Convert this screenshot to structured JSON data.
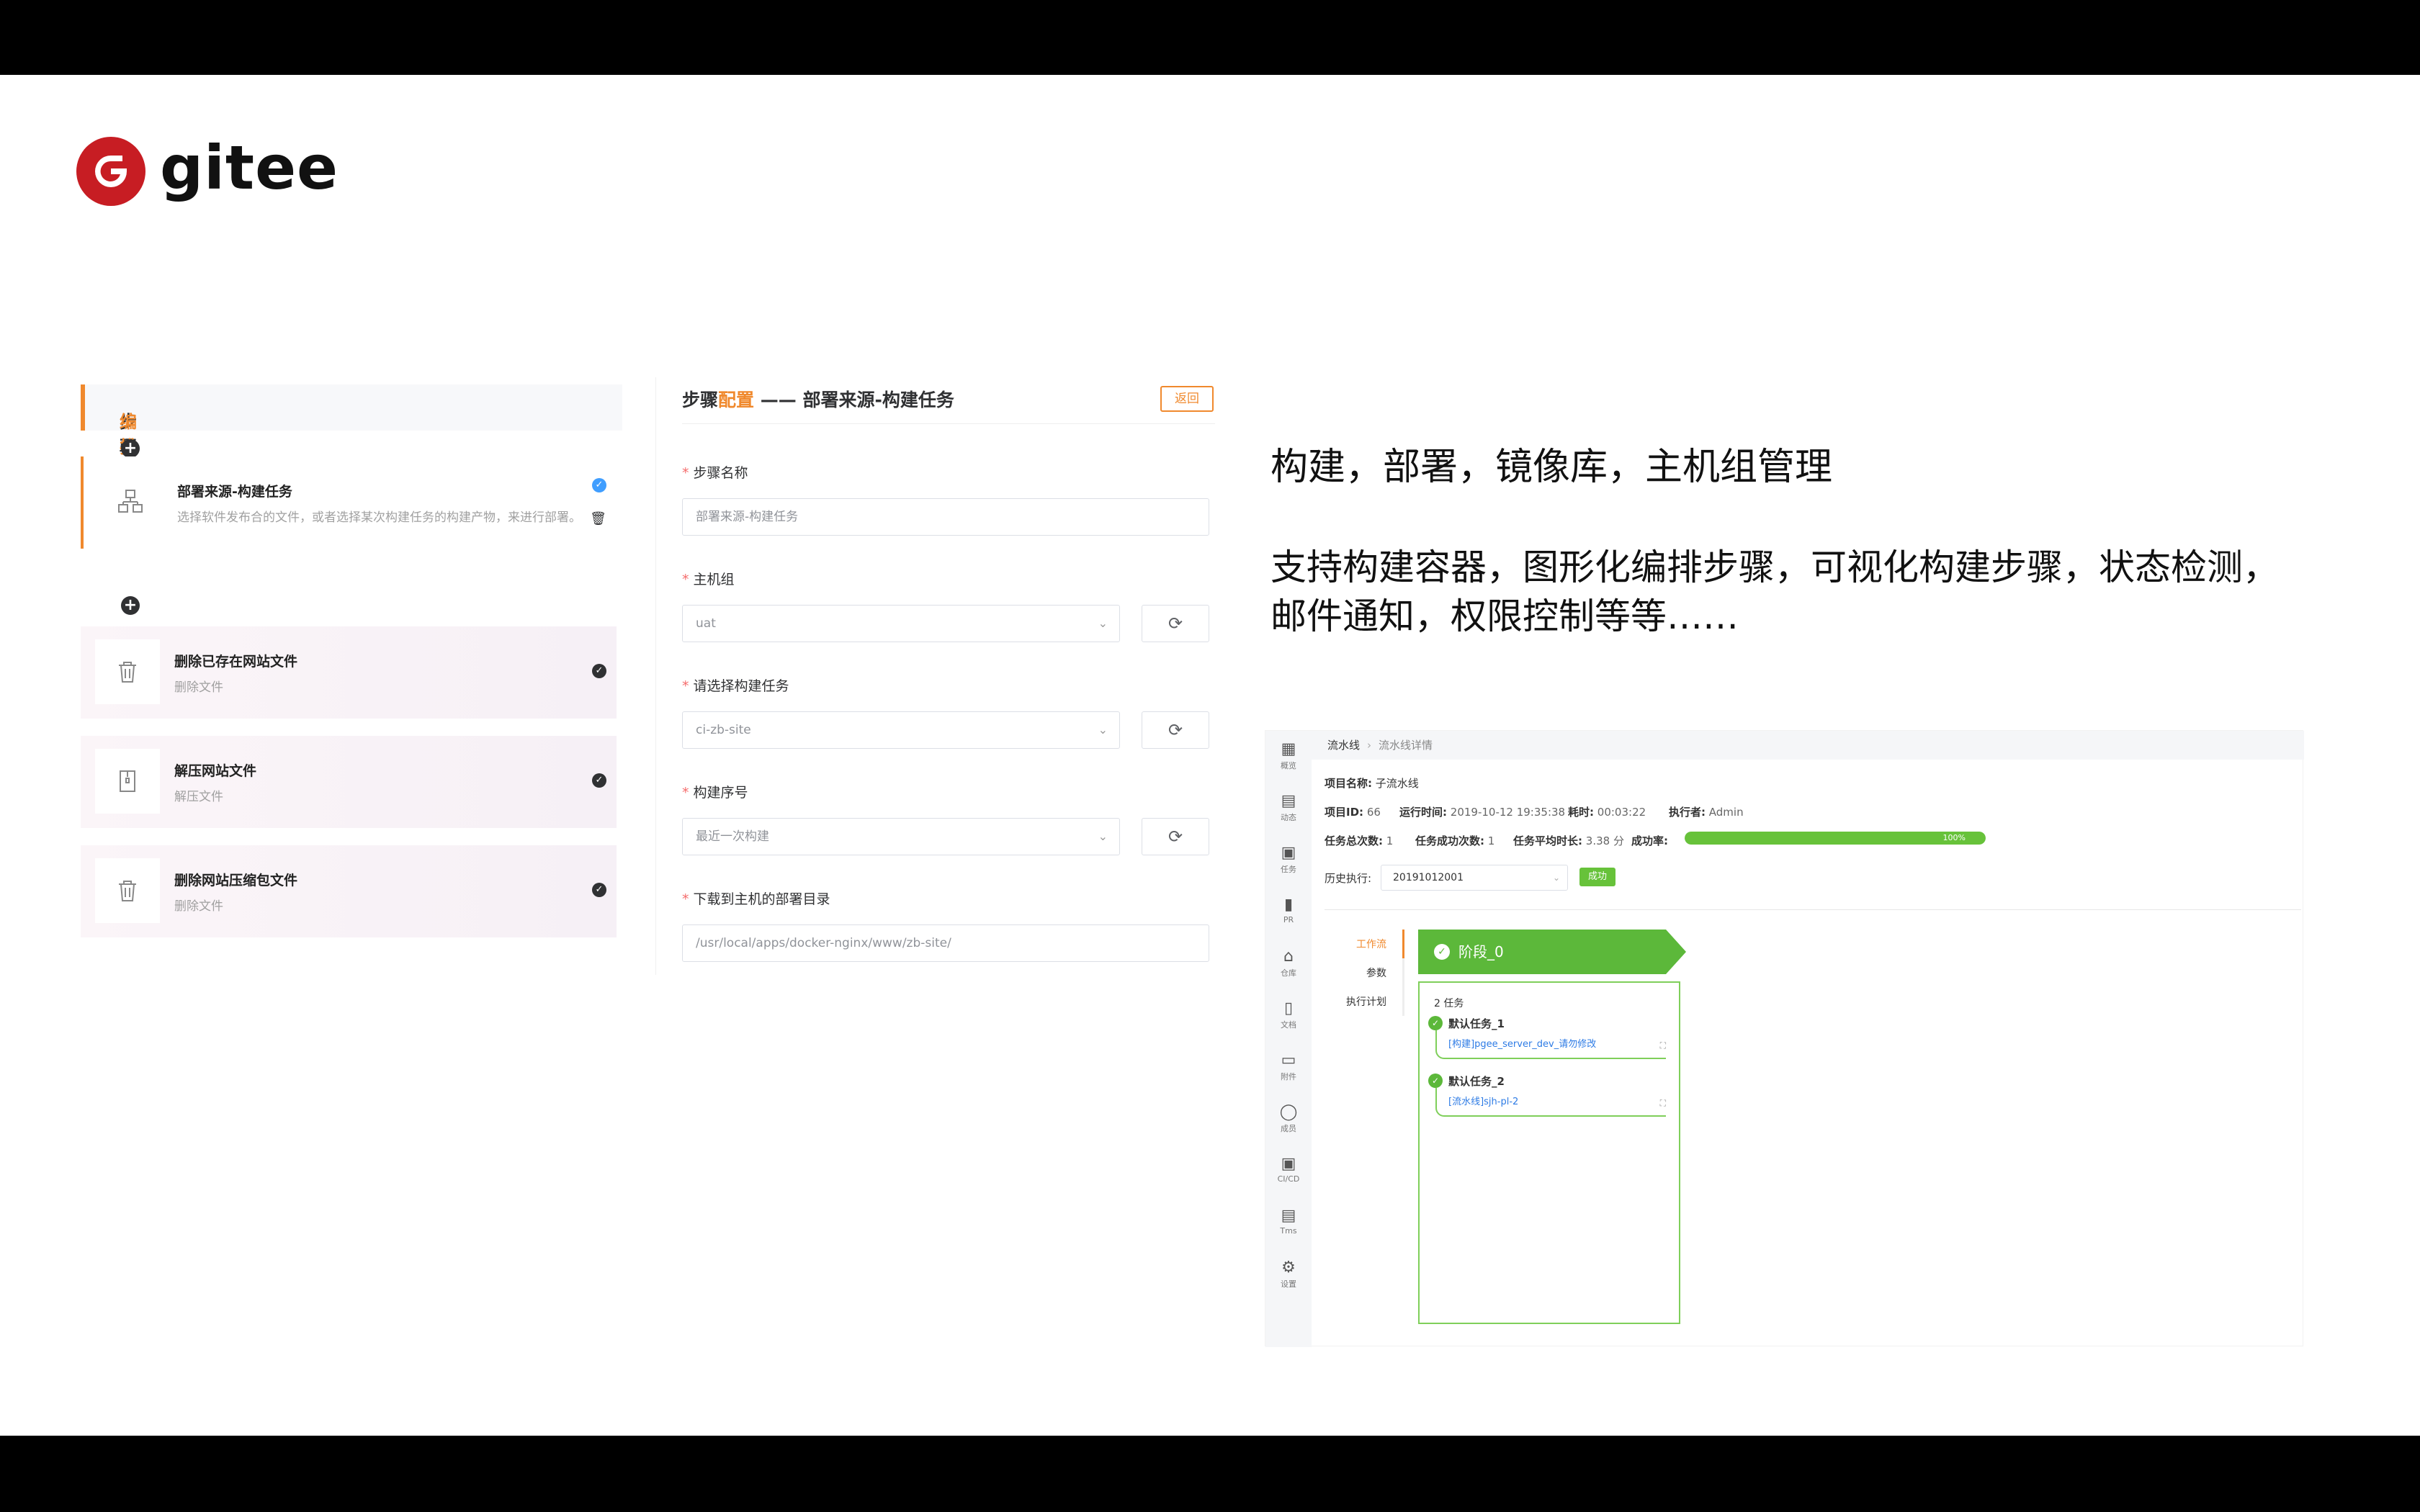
{
  "brand": {
    "name": "gitee",
    "color": "#c71d23"
  },
  "step_orchestration": {
    "title_prefix": "步骤",
    "title_highlight": "编排",
    "steps": [
      {
        "title": "部署来源-构建任务",
        "desc": "选择软件发布合的文件，或者选择某次构建任务的构建产物，来进行部署。",
        "icon": "build-task-icon"
      },
      {
        "title": "删除已存在网站文件",
        "desc": "删除文件",
        "icon": "trash-icon"
      },
      {
        "title": "解压网站文件",
        "desc": "解压文件",
        "icon": "zip-icon"
      },
      {
        "title": "删除网站压缩包文件",
        "desc": "删除文件",
        "icon": "trash-icon"
      }
    ]
  },
  "step_config": {
    "title_prefix": "步骤",
    "title_highlight": "配置",
    "title_suffix": " —— 部署来源-构建任务",
    "return_label": "返回",
    "fields": [
      {
        "label": "步骤名称",
        "placeholder": "部署来源-构建任务"
      },
      {
        "label": "主机组",
        "value": "uat"
      },
      {
        "label": "请选择构建任务",
        "value": "ci-zb-site"
      },
      {
        "label": "构建序号",
        "value": "最近一次构建"
      },
      {
        "label": "下载到主机的部署目录",
        "placeholder": "/usr/local/apps/docker-nginx/www/zb-site/"
      }
    ]
  },
  "headline": "构建，部署，镜像库，主机组管理",
  "description": "支持构建容器，图形化编排步骤，可视化构建步骤，状态检测，邮件通知，权限控制等等……",
  "pipeline": {
    "nav": [
      {
        "label": "概览",
        "icon": "grid-icon"
      },
      {
        "label": "动态",
        "icon": "chat-icon"
      },
      {
        "label": "任务",
        "icon": "clipboard-icon"
      },
      {
        "label": "PR",
        "icon": "bar-chart-icon"
      },
      {
        "label": "仓库",
        "icon": "home-icon"
      },
      {
        "label": "文档",
        "icon": "doc-icon"
      },
      {
        "label": "附件",
        "icon": "folder-icon"
      },
      {
        "label": "成员",
        "icon": "user-icon"
      },
      {
        "label": "CI/CD",
        "icon": "cicd-icon"
      },
      {
        "label": "Tms",
        "icon": "archive-icon"
      },
      {
        "label": "设置",
        "icon": "gear-icon"
      }
    ],
    "breadcrumb": [
      "流水线",
      "流水线详情"
    ],
    "project_name_label": "项目名称:",
    "project_name": "子流水线",
    "project_id_label": "项目ID:",
    "project_id": "66",
    "run_time_label": "运行时间:",
    "run_time": "2019-10-12 19:35:38",
    "duration_label": "耗时:",
    "duration": "00:03:22",
    "executor_label": "执行者:",
    "executor": "Admin",
    "total_runs_label": "任务总次数:",
    "total_runs": "1",
    "success_runs_label": "任务成功次数:",
    "success_runs": "1",
    "avg_time_label": "任务平均时长:",
    "avg_time": "3.38 分",
    "success_rate_label": "成功率:",
    "success_rate": "100%",
    "success_fraction": 1.0,
    "history_label": "历史执行:",
    "history_value": "20191012001",
    "status_badge": "成功",
    "tabs": [
      "工作流",
      "参数",
      "执行计划"
    ],
    "stage_name": "阶段_0",
    "task_count": "2 任务",
    "tasks": [
      {
        "name": "默认任务_1",
        "link": "[构建]pgee_server_dev_请勿修改"
      },
      {
        "name": "默认任务_2",
        "link": "[流水线]sjh-pl-2"
      }
    ],
    "accent_color": "#67c23a"
  }
}
